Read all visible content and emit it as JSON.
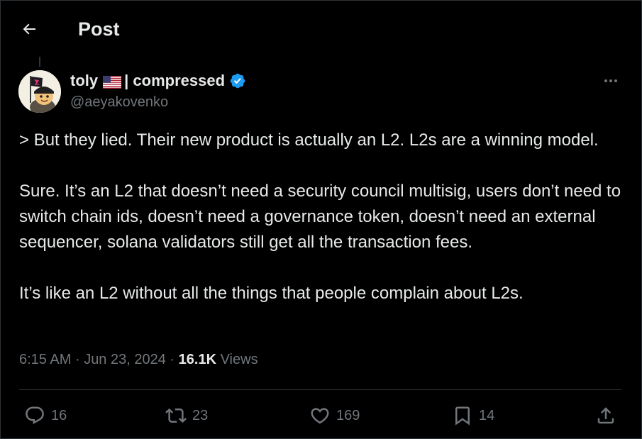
{
  "header": {
    "title": "Post"
  },
  "author": {
    "name": "toly",
    "flag": "us-flag-icon",
    "name_suffix": "| compressed",
    "handle": "@aeyakovenko",
    "verified": true,
    "verified_color": "#1d9bf0"
  },
  "tweet": {
    "paragraphs": [
      "> But they lied. Their new product is actually an L2. L2s are a winning model.",
      "Sure. It’s an L2 that doesn’t need a security council multisig, users don’t need to switch chain ids, doesn’t need a governance token, doesn’t need an external sequencer, solana validators still get all the transaction fees.",
      "It’s like an L2 without all the things that people complain about L2s."
    ]
  },
  "meta": {
    "time": "6:15 AM",
    "separator": "·",
    "date": "Jun 23, 2024",
    "views_count": "16.1K",
    "views_label": "Views"
  },
  "actions": {
    "replies": "16",
    "reposts": "23",
    "likes": "169",
    "bookmarks": "14"
  },
  "colors": {
    "background": "#000000",
    "text_primary": "#e7e9ea",
    "text_secondary": "#71767b",
    "border": "#2f3336",
    "accent": "#1d9bf0"
  }
}
